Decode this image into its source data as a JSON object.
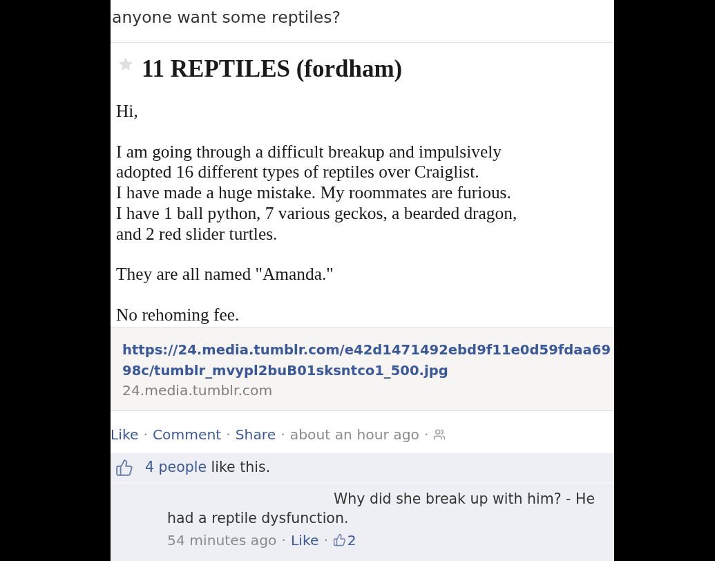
{
  "post": {
    "text": "anyone want some reptiles?"
  },
  "listing": {
    "starred": false,
    "title": "11 REPTILES (fordham)",
    "paragraphs": [
      [
        "Hi,"
      ],
      [
        "I am going through a difficult breakup and impulsively",
        "adopted 16 different types of reptiles over Craiglist.",
        "I have made a huge mistake. My roommates are furious.",
        "I have 1 ball python, 7 various geckos, a bearded dragon,",
        "and 2 red slider turtles."
      ],
      [
        "They are all named \"Amanda.\""
      ],
      [
        "No rehoming fee."
      ]
    ]
  },
  "link_preview": {
    "url": "https://24.media.tumblr.com/e42d1471492ebd9f11e0d59fdaa6998c/tumblr_mvypl2buB01sksntco1_500.jpg",
    "domain": "24.media.tumblr.com"
  },
  "actions": {
    "separator": "·",
    "items": [
      {
        "kind": "like",
        "label": "Like"
      },
      {
        "kind": "comment",
        "label": "Comment"
      },
      {
        "kind": "share",
        "label": "Share"
      },
      {
        "kind": "time",
        "label": "about an hour ago"
      },
      {
        "kind": "audience"
      }
    ]
  },
  "likes": {
    "people": "4 people",
    "text": "like this."
  },
  "comments": [
    {
      "text": "Why did she break up with him? - He had a reptile dysfunction.",
      "time": "54 minutes ago",
      "separator": "·",
      "like_label": "Like",
      "like_count": "2"
    }
  ]
}
